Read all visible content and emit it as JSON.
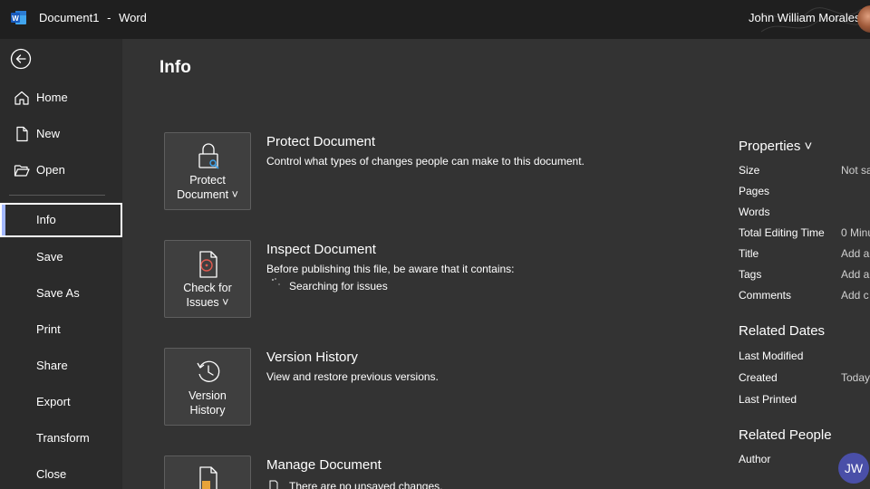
{
  "titlebar": {
    "document": "Document1",
    "separator": "-",
    "app": "Word",
    "user": "John William Morales"
  },
  "nav": {
    "items": [
      {
        "label": "Home",
        "icon": "home-icon"
      },
      {
        "label": "New",
        "icon": "new-document-icon"
      },
      {
        "label": "Open",
        "icon": "open-folder-icon"
      },
      {
        "label": "Info"
      },
      {
        "label": "Save"
      },
      {
        "label": "Save As"
      },
      {
        "label": "Print"
      },
      {
        "label": "Share"
      },
      {
        "label": "Export"
      },
      {
        "label": "Transform"
      },
      {
        "label": "Close"
      }
    ],
    "active": "Info"
  },
  "main": {
    "title": "Info",
    "sections": [
      {
        "button": [
          "Protect",
          "Document ˅"
        ],
        "title": "Protect Document",
        "desc": "Control what types of changes people can make to this document."
      },
      {
        "button": [
          "Check for",
          "Issues ˅"
        ],
        "title": "Inspect Document",
        "desc": "Before publishing this file, be aware that it contains:",
        "sub": "Searching for issues"
      },
      {
        "button": [
          "Version",
          "History"
        ],
        "title": "Version History",
        "desc": "View and restore previous versions."
      },
      {
        "title": "Manage Document",
        "desc": "There are no unsaved changes."
      }
    ]
  },
  "properties": {
    "heading": "Properties ˅",
    "rows": [
      {
        "key": "Size",
        "value": "Not sa"
      },
      {
        "key": "Pages",
        "value": ""
      },
      {
        "key": "Words",
        "value": ""
      },
      {
        "key": "Total Editing Time",
        "value": "0 Minu"
      },
      {
        "key": "Title",
        "value": "Add a"
      },
      {
        "key": "Tags",
        "value": "Add a"
      },
      {
        "key": "Comments",
        "value": "Add c"
      }
    ],
    "related_dates": {
      "heading": "Related Dates",
      "rows": [
        {
          "key": "Last Modified",
          "value": ""
        },
        {
          "key": "Created",
          "value": "Today,"
        },
        {
          "key": "Last Printed",
          "value": ""
        }
      ]
    },
    "related_people": {
      "heading": "Related People",
      "author_label": "Author",
      "author_initials": "JW"
    }
  },
  "colors": {
    "titlebar": "#1f1f1f",
    "nav": "#2b2b2b",
    "main": "#333333",
    "accent": "#a3b8ff",
    "word_blue": "#2b7cd3",
    "avatar": "#4a4fa8"
  }
}
